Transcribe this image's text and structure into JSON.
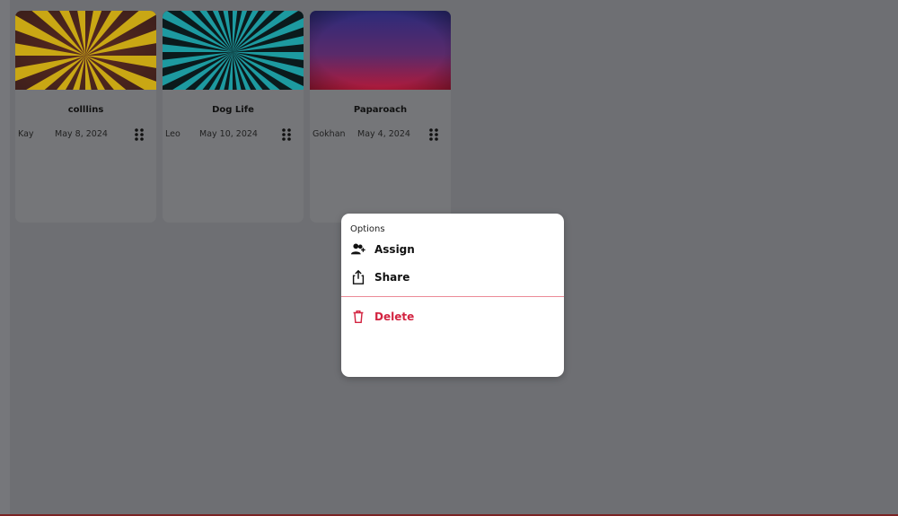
{
  "cards": [
    {
      "title": "colllins",
      "owner": "Kay",
      "date": "May 8, 2024",
      "thumb": "yellow-sunburst"
    },
    {
      "title": "Dog Life",
      "owner": "Leo",
      "date": "May 10, 2024",
      "thumb": "teal-sunburst"
    },
    {
      "title": "Paparoach",
      "owner": "Gokhan",
      "date": "May 4, 2024",
      "thumb": "purple-red-gradient"
    }
  ],
  "popup": {
    "heading": "Options",
    "items": [
      {
        "label": "Assign",
        "icon": "assign-user-icon"
      },
      {
        "label": "Share",
        "icon": "share-icon"
      },
      {
        "label": "Delete",
        "icon": "trash-icon"
      }
    ]
  },
  "colors": {
    "danger": "#d32441",
    "overlay": "#6e6f73"
  }
}
